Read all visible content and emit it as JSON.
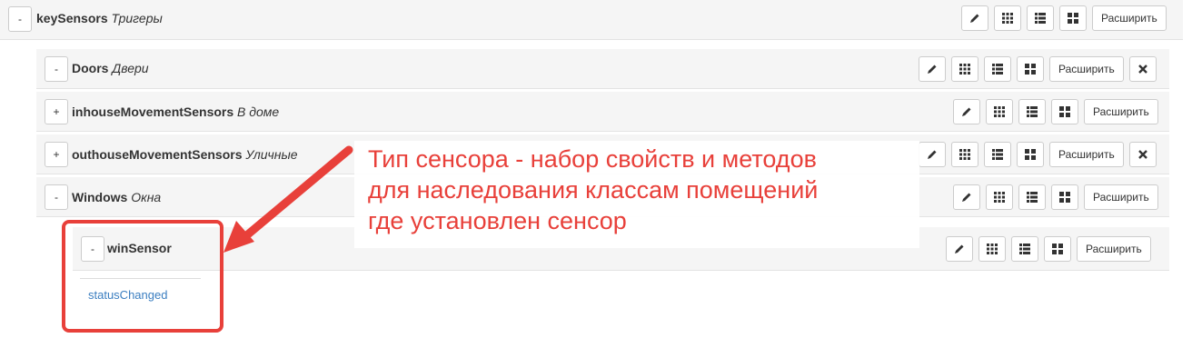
{
  "expand_label": "Расширить",
  "icons": {
    "edit": "pencil-icon",
    "grid": "grid-icon",
    "list": "list-icon",
    "tiles": "tiles-icon",
    "delete": "close-icon"
  },
  "rows": [
    {
      "toggle": "-",
      "name": "keySensors",
      "desc": "Тригеры"
    },
    {
      "toggle": "-",
      "name": "Doors",
      "desc": "Двери"
    },
    {
      "toggle": "+",
      "name": "inhouseMovementSensors",
      "desc": "В доме"
    },
    {
      "toggle": "+",
      "name": "outhouseMovementSensors",
      "desc": "Уличные"
    },
    {
      "toggle": "-",
      "name": "Windows",
      "desc": "Окна"
    },
    {
      "toggle": "-",
      "name": "winSensor",
      "desc": ""
    }
  ],
  "methods": [
    "statusChanged"
  ],
  "annotation": {
    "line1": "Тип сенсора - набор свойств и методов",
    "line2": "для наследования классам помещений",
    "line3": "где установлен сенсор"
  },
  "colors": {
    "annotation": "#e8403a",
    "link": "#3b7ec0",
    "row_bg": "#f5f5f5"
  }
}
